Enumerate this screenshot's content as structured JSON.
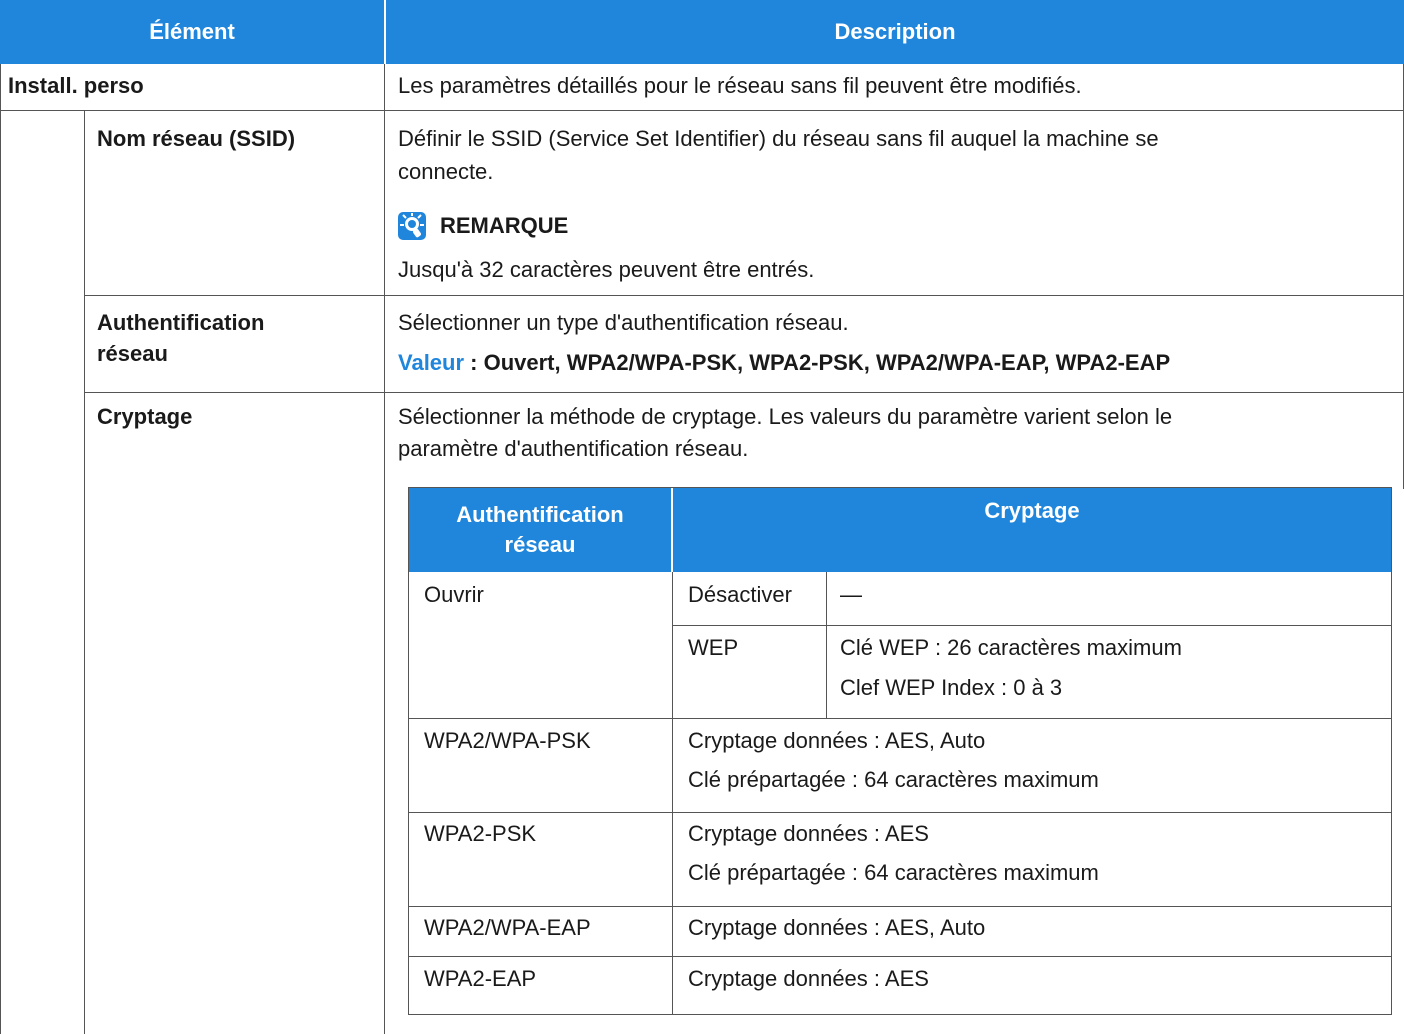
{
  "header": {
    "col1": "Élément",
    "col2": "Description"
  },
  "rows": {
    "install": {
      "label": "Install. perso",
      "desc": "Les paramètres détaillés pour le réseau sans fil peuvent être modifiés."
    },
    "ssid": {
      "label": "Nom réseau (SSID)",
      "desc_line1": "Définir le SSID (Service Set Identifier) du réseau sans fil auquel la machine se",
      "desc_line2": "connecte.",
      "note_title": "REMARQUE",
      "note_text": "Jusqu'à 32 caractères peuvent être entrés."
    },
    "auth": {
      "label_line1": "Authentification",
      "label_line2": "réseau",
      "desc": "Sélectionner un type d'authentification réseau.",
      "value_label": "Valeur",
      "value_text": " : Ouvert, WPA2/WPA-PSK, WPA2-PSK, WPA2/WPA-EAP, WPA2-EAP"
    },
    "crypt": {
      "label": "Cryptage",
      "desc_line1": "Sélectionner la méthode de cryptage. Les valeurs du paramètre varient selon le",
      "desc_line2": "paramètre d'authentification réseau."
    }
  },
  "inner_table": {
    "header_auth_line1": "Authentification",
    "header_auth_line2": "réseau",
    "header_crypt": "Cryptage",
    "rows": [
      {
        "auth": "Ouvrir",
        "sub": [
          {
            "type": "Désactiver",
            "detail": [
              "—"
            ]
          },
          {
            "type": "WEP",
            "detail": [
              "Clé WEP : 26 caractères maximum",
              "Clef WEP Index : 0 à 3"
            ]
          }
        ]
      },
      {
        "auth": "WPA2/WPA-PSK",
        "detail": [
          "Cryptage données : AES, Auto",
          "Clé prépartagée : 64 caractères maximum"
        ]
      },
      {
        "auth": "WPA2-PSK",
        "detail": [
          "Cryptage données : AES",
          "Clé prépartagée : 64 caractères maximum"
        ]
      },
      {
        "auth": "WPA2/WPA-EAP",
        "detail": [
          "Cryptage données : AES, Auto"
        ]
      },
      {
        "auth": "WPA2-EAP",
        "detail": [
          "Cryptage données : AES"
        ]
      }
    ]
  },
  "colors": {
    "header_bg": "#1f86dc",
    "rule": "#555555"
  },
  "icons": {
    "note": "note-lightbulb-icon"
  }
}
